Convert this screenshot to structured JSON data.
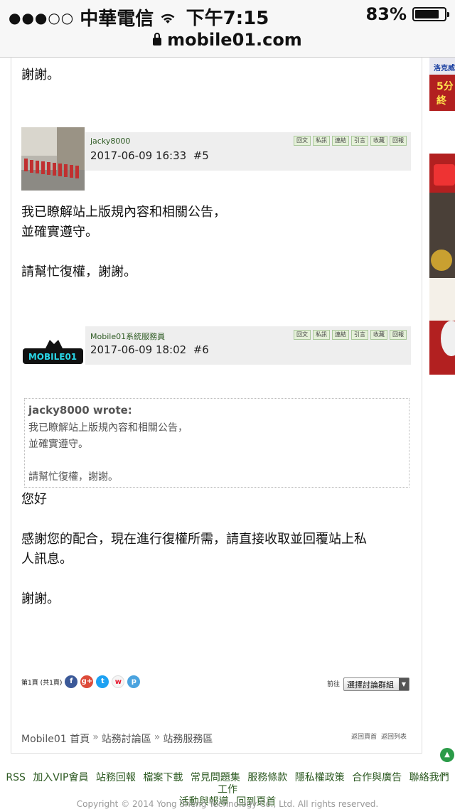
{
  "status": {
    "carrier": "中華電信",
    "time": "下午7:15",
    "battery": "83%",
    "battery_level": 0.83
  },
  "browser": {
    "url": "mobile01.com"
  },
  "posts": [
    {
      "author": "jacky8000",
      "date": "2017-06-09 16:33",
      "floor": "#5",
      "lines": [
        "我已瞭解站上版規內容和相關公告，",
        "並確實遵守。",
        "",
        "請幫忙復權，謝謝。"
      ]
    },
    {
      "author": "Mobile01系統服務員",
      "date": "2017-06-09 18:02",
      "floor": "#6",
      "quote_author": "jacky8000 wrote:",
      "quote_lines": [
        "我已瞭解站上版規內容和相關公告，",
        "並確實遵守。",
        "",
        "請幫忙復權，謝謝。"
      ],
      "lines": [
        "您好",
        "",
        "感謝您的配合，現在進行復權所需，請直接收取並回覆站上私",
        "人訊息。",
        "",
        "謝謝。"
      ]
    }
  ],
  "previous_text": "謝謝。",
  "post_buttons": [
    "回文",
    "私訊",
    "連結",
    "引言",
    "收藏",
    "回報"
  ],
  "pager": {
    "label": "第1頁 (共1頁)"
  },
  "goto_label": "前往",
  "group_select": "選擇討論群組",
  "breadcrumb": [
    "Mobile01 首頁",
    "站務討論區",
    "站務服務區"
  ],
  "breadcrumb_sep": "»",
  "back_links": [
    "返回頁首",
    "返回列表"
  ],
  "ad": {
    "header": "洛克威",
    "line1": "5分",
    "line2": "終"
  },
  "footer_links": [
    "RSS",
    "加入VIP會員",
    "站務回報",
    "檔案下載",
    "常見問題集",
    "服務條款",
    "隱私權政策",
    "合作與廣告",
    "聯絡我們",
    "工作",
    "活動與報導",
    "回到頁首"
  ],
  "copyright": "Copyright © 2014 Yong Sheng Technology Co., Ltd. All rights reserved."
}
